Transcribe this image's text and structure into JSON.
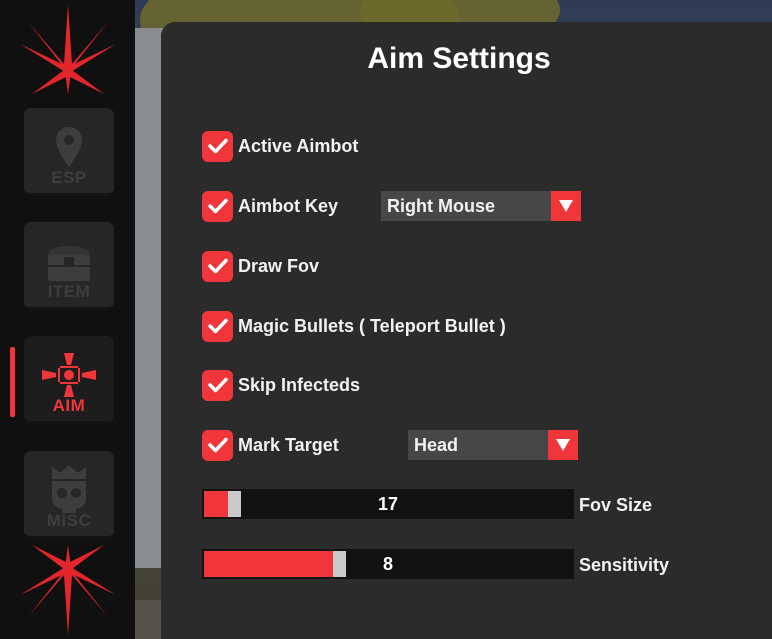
{
  "colors": {
    "accent": "#f0363a",
    "panel": "#2b2b2b",
    "sidebar": "#101010"
  },
  "sidebar": {
    "items": [
      {
        "label": "ESP",
        "icon": "map-pin-icon",
        "active": false
      },
      {
        "label": "ITEM",
        "icon": "treasure-chest-icon",
        "active": false
      },
      {
        "label": "AIM",
        "icon": "crosshair-icon",
        "active": true
      },
      {
        "label": "MISC",
        "icon": "skull-crown-icon",
        "active": false
      }
    ]
  },
  "panel": {
    "title": "Aim Settings",
    "options": [
      {
        "label": "Active Aimbot",
        "checked": true
      },
      {
        "label": "Aimbot Key",
        "checked": true
      },
      {
        "label": "Draw Fov",
        "checked": true
      },
      {
        "label": "Magic Bullets ( Teleport Bullet )",
        "checked": true
      },
      {
        "label": "Skip Infecteds",
        "checked": true
      },
      {
        "label": "Mark Target",
        "checked": true
      }
    ],
    "aimbot_key_dropdown": {
      "value": "Right Mouse"
    },
    "mark_target_dropdown": {
      "value": "Head"
    },
    "sliders": [
      {
        "label": "Fov Size",
        "value": "17",
        "fraction": 0.065
      },
      {
        "label": "Sensitivity",
        "value": "8",
        "fraction": 0.35
      }
    ]
  }
}
